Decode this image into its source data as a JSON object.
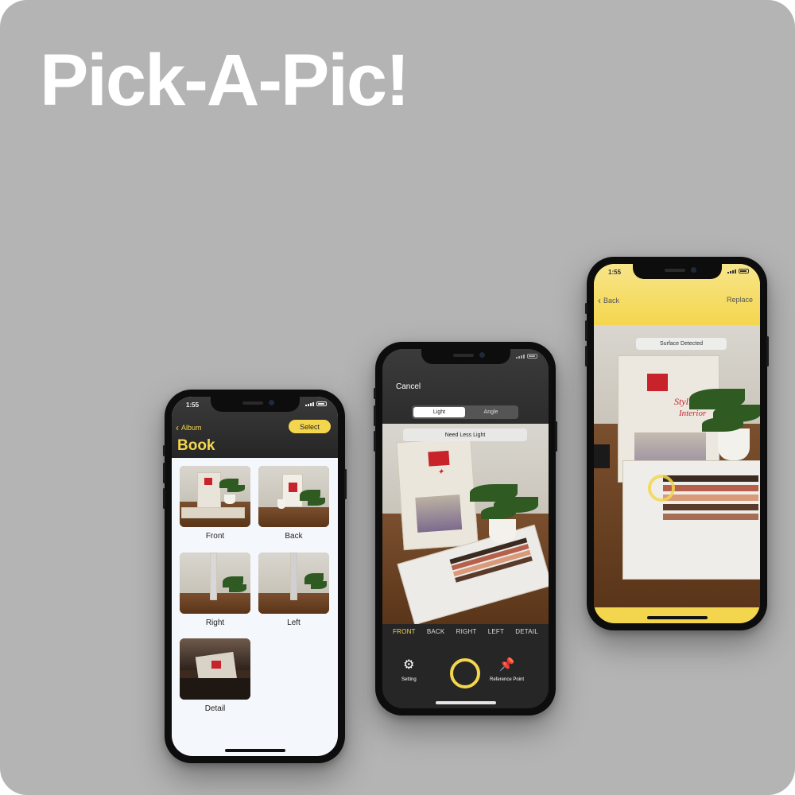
{
  "hero": {
    "title": "Pick-A-Pic!"
  },
  "colors": {
    "background": "#b4b4b4",
    "accent": "#f4d64e",
    "dark": "#262626"
  },
  "phone_album": {
    "status_time": "1:55",
    "back_label": "Album",
    "select_label": "Select",
    "title": "Book",
    "thumbnails": [
      {
        "label": "Front"
      },
      {
        "label": "Back"
      },
      {
        "label": "Right"
      },
      {
        "label": "Left"
      },
      {
        "label": "Detail"
      }
    ]
  },
  "phone_camera": {
    "cancel_label": "Cancel",
    "segments": [
      "Light",
      "Angle"
    ],
    "active_segment": "Light",
    "message": "Need Less Light",
    "modes": [
      "FRONT",
      "BACK",
      "RIGHT",
      "LEFT",
      "DETAIL"
    ],
    "active_mode": "FRONT",
    "setting_label": "Setting",
    "reference_label": "Reference Point",
    "setting_icon": "gear-icon",
    "reference_icon": "pushpin-icon"
  },
  "phone_ar": {
    "status_time": "1:55",
    "back_label": "Back",
    "replace_label": "Replace",
    "message": "Surface Detected"
  }
}
